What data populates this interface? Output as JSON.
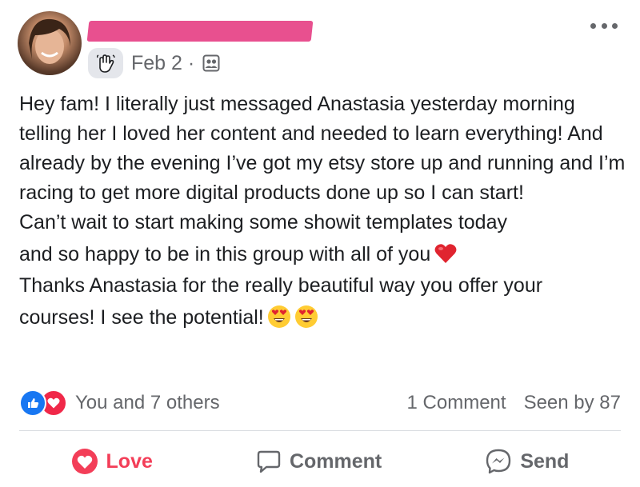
{
  "post": {
    "date": "Feb 2 ·",
    "paragraphs": [
      "Hey fam! I literally just messaged Anastasia yesterday morning telling her I loved her content and needed to learn everything! And already by the evening I’ve got my etsy store up and running and I’m racing to get more digital products done up so I can start!",
      "Can’t wait to start making some showit templates today",
      "and so happy to be in this group with all of you",
      "Thanks Anastasia for the really beautiful way you offer your",
      "courses! I see the potential!"
    ],
    "emojis": {
      "heart": "red-heart-emoji",
      "heart_eyes": "heart-eyes-emoji"
    }
  },
  "reactions": {
    "summary": "You and 7 others",
    "comments": "1 Comment",
    "seen_by": "Seen by 87"
  },
  "actions": {
    "love": "Love",
    "comment": "Comment",
    "send": "Send"
  },
  "colors": {
    "accent_love": "#f33e58",
    "like_blue": "#1877f2",
    "muted": "#65676b",
    "redaction": "#e8508f"
  },
  "icons": [
    "more-icon",
    "wave-badge-icon",
    "privacy-group-icon",
    "like-reaction-icon",
    "love-reaction-icon",
    "heart-icon",
    "comment-icon",
    "messenger-icon"
  ]
}
